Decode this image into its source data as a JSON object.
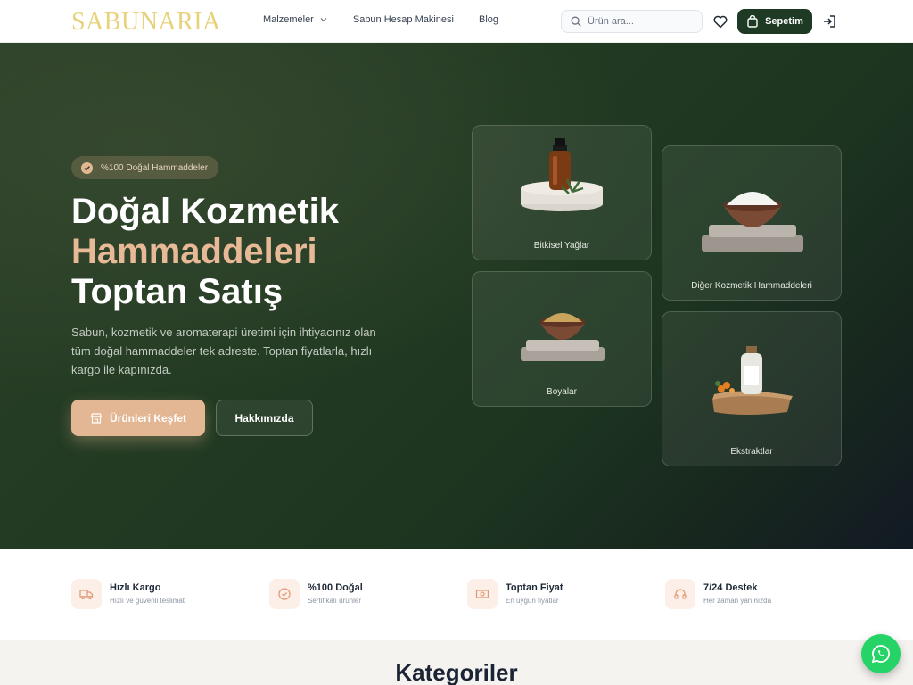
{
  "header": {
    "logo": "SABUNARIA",
    "nav": [
      {
        "label": "Malzemeler",
        "has_dropdown": true
      },
      {
        "label": "Sabun Hesap Makinesi"
      },
      {
        "label": "Blog"
      }
    ],
    "search_placeholder": "Ürün ara...",
    "cart_label": "Sepetim"
  },
  "hero": {
    "badge": "%100 Doğal Hammaddeler",
    "title_line1": "Doğal Kozmetik",
    "title_line2": "Hammaddeleri",
    "title_line3": "Toptan Satış",
    "description": "Sabun, kozmetik ve aromaterapi üretimi için ihtiyacınız olan tüm doğal hammaddeler tek adreste. Toptan fiyatlarla, hızlı kargo ile kapınızda.",
    "primary_button": "Ürünleri Keşfet",
    "secondary_button": "Hakkımızda",
    "cards": [
      {
        "label": "Bitkisel Yağlar"
      },
      {
        "label": "Diğer Kozmetik Hammaddeleri"
      },
      {
        "label": "Boyalar"
      },
      {
        "label": "Ekstraktlar"
      }
    ]
  },
  "features": [
    {
      "title": "Hızlı Kargo",
      "subtitle": "Hızlı ve güvenli teslimat",
      "icon": "truck-icon"
    },
    {
      "title": "%100 Doğal",
      "subtitle": "Sertifikalı ürünler",
      "icon": "certified-icon"
    },
    {
      "title": "Toptan Fiyat",
      "subtitle": "En uygun fiyatlar",
      "icon": "money-icon"
    },
    {
      "title": "7/24 Destek",
      "subtitle": "Her zaman yanınızda",
      "icon": "headset-icon"
    }
  ],
  "categories": {
    "title": "Kategoriler"
  },
  "colors": {
    "brand_green": "#1e3a24",
    "accent": "#e4b794",
    "logo": "#e7d27a",
    "whatsapp": "#25d366"
  }
}
